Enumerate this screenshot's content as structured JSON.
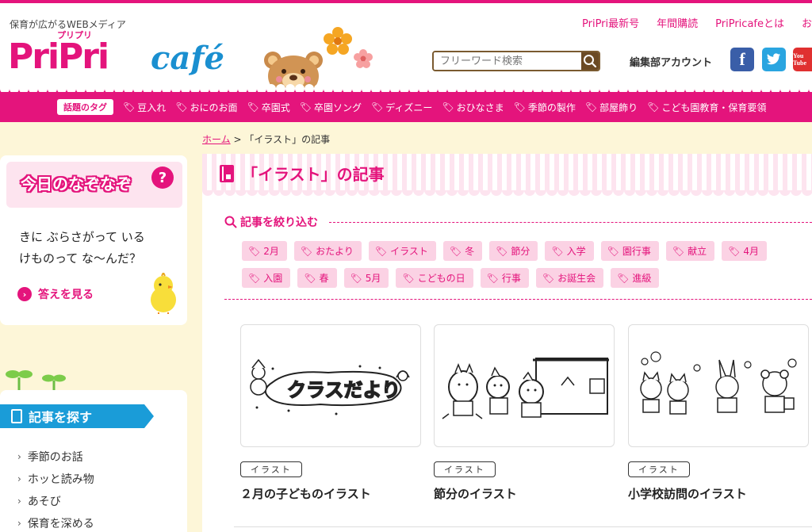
{
  "header": {
    "tagline": "保育が広がるWEBメディア",
    "logo_ruby": "プリプリ",
    "logo_main": "PriPri",
    "logo_cafe": "café",
    "nav": [
      "PriPri最新号",
      "年間購読",
      "PriPricafeとは",
      "お"
    ],
    "search_placeholder": "フリーワード検索",
    "account_label": "編集部アカウント",
    "social": {
      "facebook": "f",
      "twitter": "t",
      "youtube": "You Tube"
    }
  },
  "tagbar": {
    "title": "話題のタグ",
    "tags": [
      "豆入れ",
      "おにのお面",
      "卒園式",
      "卒園ソング",
      "ディズニー",
      "おひなさま",
      "季節の製作",
      "部屋飾り",
      "こども園教育・保育要領"
    ]
  },
  "breadcrumb": {
    "home": "ホーム",
    "separator": ">",
    "current": "「イラスト」の記事"
  },
  "sidebar": {
    "riddle": {
      "title": "今日のなぞなぞ",
      "badge": "?",
      "line1": "きに ぶらさがって いる",
      "line2": "けものって な～んだ？",
      "answer_label": "答えを見る"
    },
    "search_section": {
      "title": "記事を探す",
      "categories": [
        "季節のお話",
        "ホッと読み物",
        "あそび",
        "保育を深める"
      ]
    }
  },
  "main": {
    "title": "「イラスト」の記事",
    "filter_title": "記事を絞り込む",
    "chips": [
      "2月",
      "おたより",
      "イラスト",
      "冬",
      "節分",
      "入学",
      "園行事",
      "献立",
      "4月",
      "入園",
      "春",
      "5月",
      "こどもの日",
      "行事",
      "お誕生会",
      "進級"
    ],
    "cards": [
      {
        "tag": "イラスト",
        "title": "２月の子どものイラスト",
        "image_text": "クラスだより"
      },
      {
        "tag": "イラスト",
        "title": "節分のイラスト"
      },
      {
        "tag": "イラスト",
        "title": "小学校訪問のイラスト"
      }
    ]
  },
  "colors": {
    "brand_pink": "#e4147c",
    "accent_blue": "#1a9cd8",
    "background": "#fdf6d8"
  }
}
